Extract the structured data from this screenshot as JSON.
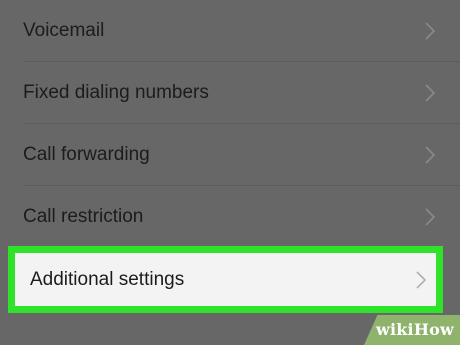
{
  "settings": {
    "items": [
      {
        "label": "Voicemail"
      },
      {
        "label": "Fixed dialing numbers"
      },
      {
        "label": "Call forwarding"
      },
      {
        "label": "Call restriction"
      },
      {
        "label": "Additional settings"
      }
    ]
  },
  "watermark": {
    "brand_prefix": "wiki",
    "brand_suffix": "How"
  },
  "colors": {
    "overlay_background": "#676767",
    "highlight_border": "#2fe32a",
    "highlight_row_background": "#f3f3f3",
    "label_text": "#1c1c1c",
    "chevron": "#8a8a8a",
    "watermark_background": "#8fb36d"
  },
  "icons": {
    "row_chevron": "chevron-right-icon"
  }
}
